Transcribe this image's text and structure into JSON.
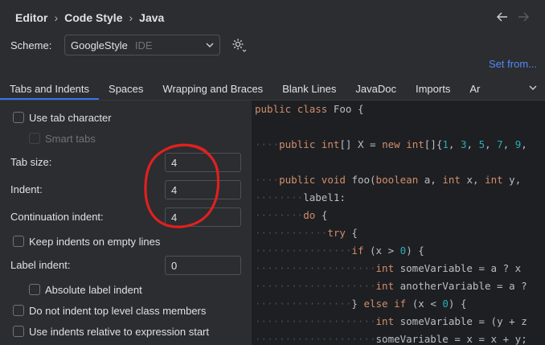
{
  "breadcrumb": [
    "Editor",
    "Code Style",
    "Java"
  ],
  "nav": {
    "back_icon": "arrow-left-icon",
    "forward_icon": "arrow-right-icon"
  },
  "scheme": {
    "label": "Scheme:",
    "value": "GoogleStyle",
    "kind": "IDE"
  },
  "set_from": "Set from...",
  "tabs": [
    "Tabs and Indents",
    "Spaces",
    "Wrapping and Braces",
    "Blank Lines",
    "JavaDoc",
    "Imports",
    "Ar"
  ],
  "options": {
    "use_tab_character": "Use tab character",
    "smart_tabs": "Smart tabs",
    "tab_size_label": "Tab size:",
    "tab_size": "4",
    "indent_label": "Indent:",
    "indent": "4",
    "continuation_indent_label": "Continuation indent:",
    "continuation_indent": "4",
    "keep_indents": "Keep indents on empty lines",
    "label_indent_label": "Label indent:",
    "label_indent": "0",
    "absolute_label_indent": "Absolute label indent",
    "no_indent_top_level": "Do not indent top level class members",
    "relative_indents": "Use indents relative to expression start"
  },
  "code_lines": [
    "public class Foo {",
    "",
    "····public int[] X = new int[]{1, 3, 5, 7, 9,",
    "",
    "····public void foo(boolean a, int x, int y,",
    "········label1:",
    "········do {",
    "············try {",
    "················if (x > 0) {",
    "····················int someVariable = a ? x",
    "····················int anotherVariable = a ?",
    "················} else if (x < 0) {",
    "····················int someVariable = (y + z",
    "····················someVariable = x = x + y;"
  ],
  "colors": {
    "accent": "#3574f0",
    "link": "#548af7",
    "annotation": "#e02020"
  }
}
